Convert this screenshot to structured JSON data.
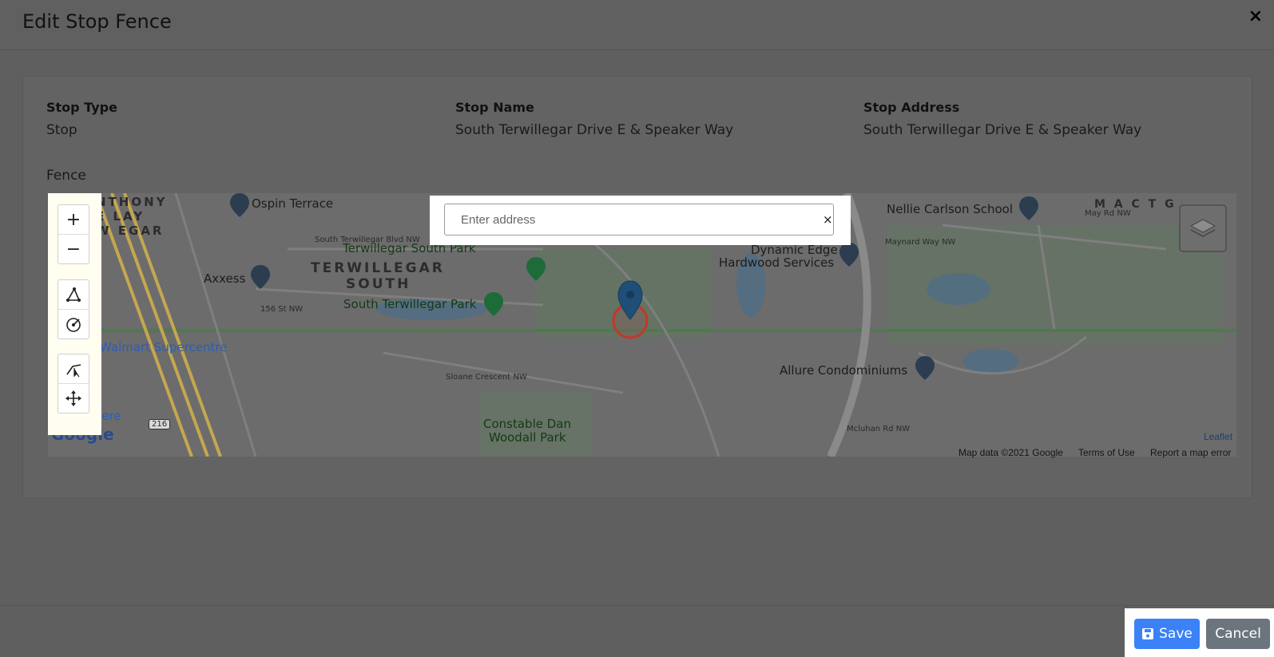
{
  "dialog": {
    "title": "Edit Stop Fence",
    "close_label": "×"
  },
  "fields": {
    "stop_type": {
      "label": "Stop Type",
      "value": "Stop"
    },
    "stop_name": {
      "label": "Stop Name",
      "value": "South Terwillegar Drive E & Speaker Way"
    },
    "stop_address": {
      "label": "Stop Address",
      "value": "South Terwillegar Drive E & Speaker Way"
    }
  },
  "fence_label": "Fence",
  "map": {
    "search_placeholder": "Enter address",
    "search_clear": "×",
    "zoom_in": "+",
    "zoom_out": "−",
    "labels": {
      "ospin_terrace": "Ospin Terrace",
      "terwillegar_south_park": "Terwillegar South Park",
      "terwillegar_south_area_1": "TERWILLEGAR",
      "terwillegar_south_area_2": "SOUTH",
      "axxess": "Axxess",
      "south_terwillegar_park": "South Terwillegar Park",
      "walmart": "Walmart Supercentre",
      "windermere": "Windermere",
      "nellie_carlson": "Nellie Carlson School",
      "dynamic_edge_1": "Dynamic Edge",
      "dynamic_edge_2": "Hardwood Services",
      "allure": "Allure Condominiums",
      "constable_1": "Constable Dan",
      "constable_2": "Woodall Park",
      "anthony_1": "NTHONY",
      "anthony_2": "E   LAY",
      "anthony_3": "W   EGAR",
      "road_south_terwillegar_blvd": "South Terwillegar Blvd NW",
      "road_sloane": "Sloane Crescent NW",
      "road_mcluhan": "Mcluhan Rd NW",
      "road_may": "May Rd NW",
      "road_maynard": "Maynard Way NW",
      "road_156": "156 St NW",
      "hwy_216": "216",
      "map_corner_top_right": "M A C T  G"
    },
    "attribution": {
      "leaflet": "Leaflet",
      "map_data": "Map data ©2021 Google",
      "terms": "Terms of Use",
      "report": "Report a map error",
      "google": "Google"
    }
  },
  "footer": {
    "save_label": "Save",
    "cancel_label": "Cancel"
  },
  "colors": {
    "save": "#3b82f6",
    "cancel": "#6c757d",
    "fence_circle": "#c0392b",
    "marker": "#1f4e78"
  }
}
